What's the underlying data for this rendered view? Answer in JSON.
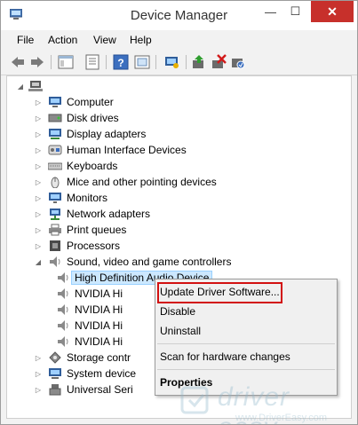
{
  "window": {
    "title": "Device Manager",
    "controls": {
      "minimize": "—",
      "maximize": "☐",
      "close": "✕"
    }
  },
  "menubar": {
    "items": [
      "File",
      "Action",
      "View",
      "Help"
    ]
  },
  "toolbar": {
    "buttons": [
      "back-arrow-icon",
      "forward-arrow-icon",
      "show-hide-tree-icon",
      "properties-icon",
      "help-icon",
      "show-devices-icon",
      "update-driver-icon",
      "uninstall-device-icon",
      "scan-hardware-icon"
    ]
  },
  "tree": {
    "root_icon": "computer-root-icon",
    "nodes": [
      {
        "label": "Computer",
        "icon": "computer-icon",
        "expanded": false
      },
      {
        "label": "Disk drives",
        "icon": "disk-drive-icon",
        "expanded": false
      },
      {
        "label": "Display adapters",
        "icon": "display-adapter-icon",
        "expanded": false
      },
      {
        "label": "Human Interface Devices",
        "icon": "hid-icon",
        "expanded": false
      },
      {
        "label": "Keyboards",
        "icon": "keyboard-icon",
        "expanded": false
      },
      {
        "label": "Mice and other pointing devices",
        "icon": "mouse-icon",
        "expanded": false
      },
      {
        "label": "Monitors",
        "icon": "monitor-icon",
        "expanded": false
      },
      {
        "label": "Network adapters",
        "icon": "network-adapter-icon",
        "expanded": false
      },
      {
        "label": "Print queues",
        "icon": "printer-icon",
        "expanded": false
      },
      {
        "label": "Processors",
        "icon": "processor-icon",
        "expanded": false
      },
      {
        "label": "Sound, video and game controllers",
        "icon": "speaker-icon",
        "expanded": true
      },
      {
        "label": "High Definition Audio Device",
        "icon": "speaker-icon",
        "child": true,
        "selected": true
      },
      {
        "label": "NVIDIA Hi",
        "icon": "speaker-icon",
        "child": true
      },
      {
        "label": "NVIDIA Hi",
        "icon": "speaker-icon",
        "child": true
      },
      {
        "label": "NVIDIA Hi",
        "icon": "speaker-icon",
        "child": true
      },
      {
        "label": "NVIDIA Hi",
        "icon": "speaker-icon",
        "child": true
      },
      {
        "label": "Storage contr",
        "icon": "storage-controller-icon",
        "expanded": false
      },
      {
        "label": "System device",
        "icon": "system-device-icon",
        "expanded": false
      },
      {
        "label": "Universal Seri",
        "icon": "usb-icon",
        "expanded": false
      }
    ]
  },
  "context_menu": {
    "items": [
      "Update Driver Software...",
      "Disable",
      "Uninstall",
      "Scan for hardware changes",
      "Properties"
    ],
    "highlighted": "Update Driver Software..."
  },
  "watermark": {
    "brand": "driver easy",
    "url": "www.DriverEasy.com"
  },
  "colors": {
    "close_button": "#c7302b",
    "selection": "#cce8ff",
    "highlight_box": "#d21010",
    "watermark": "#8fb6c9"
  }
}
